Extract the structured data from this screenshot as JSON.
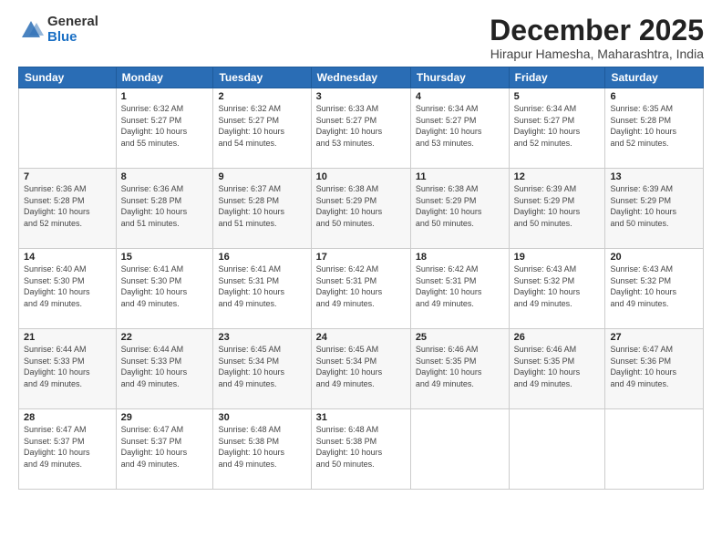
{
  "logo": {
    "general": "General",
    "blue": "Blue"
  },
  "title": "December 2025",
  "location": "Hirapur Hamesha, Maharashtra, India",
  "days_of_week": [
    "Sunday",
    "Monday",
    "Tuesday",
    "Wednesday",
    "Thursday",
    "Friday",
    "Saturday"
  ],
  "weeks": [
    [
      {
        "day": "",
        "info": ""
      },
      {
        "day": "1",
        "info": "Sunrise: 6:32 AM\nSunset: 5:27 PM\nDaylight: 10 hours\nand 55 minutes."
      },
      {
        "day": "2",
        "info": "Sunrise: 6:32 AM\nSunset: 5:27 PM\nDaylight: 10 hours\nand 54 minutes."
      },
      {
        "day": "3",
        "info": "Sunrise: 6:33 AM\nSunset: 5:27 PM\nDaylight: 10 hours\nand 53 minutes."
      },
      {
        "day": "4",
        "info": "Sunrise: 6:34 AM\nSunset: 5:27 PM\nDaylight: 10 hours\nand 53 minutes."
      },
      {
        "day": "5",
        "info": "Sunrise: 6:34 AM\nSunset: 5:27 PM\nDaylight: 10 hours\nand 52 minutes."
      },
      {
        "day": "6",
        "info": "Sunrise: 6:35 AM\nSunset: 5:28 PM\nDaylight: 10 hours\nand 52 minutes."
      }
    ],
    [
      {
        "day": "7",
        "info": "Sunrise: 6:36 AM\nSunset: 5:28 PM\nDaylight: 10 hours\nand 52 minutes."
      },
      {
        "day": "8",
        "info": "Sunrise: 6:36 AM\nSunset: 5:28 PM\nDaylight: 10 hours\nand 51 minutes."
      },
      {
        "day": "9",
        "info": "Sunrise: 6:37 AM\nSunset: 5:28 PM\nDaylight: 10 hours\nand 51 minutes."
      },
      {
        "day": "10",
        "info": "Sunrise: 6:38 AM\nSunset: 5:29 PM\nDaylight: 10 hours\nand 50 minutes."
      },
      {
        "day": "11",
        "info": "Sunrise: 6:38 AM\nSunset: 5:29 PM\nDaylight: 10 hours\nand 50 minutes."
      },
      {
        "day": "12",
        "info": "Sunrise: 6:39 AM\nSunset: 5:29 PM\nDaylight: 10 hours\nand 50 minutes."
      },
      {
        "day": "13",
        "info": "Sunrise: 6:39 AM\nSunset: 5:29 PM\nDaylight: 10 hours\nand 50 minutes."
      }
    ],
    [
      {
        "day": "14",
        "info": "Sunrise: 6:40 AM\nSunset: 5:30 PM\nDaylight: 10 hours\nand 49 minutes."
      },
      {
        "day": "15",
        "info": "Sunrise: 6:41 AM\nSunset: 5:30 PM\nDaylight: 10 hours\nand 49 minutes."
      },
      {
        "day": "16",
        "info": "Sunrise: 6:41 AM\nSunset: 5:31 PM\nDaylight: 10 hours\nand 49 minutes."
      },
      {
        "day": "17",
        "info": "Sunrise: 6:42 AM\nSunset: 5:31 PM\nDaylight: 10 hours\nand 49 minutes."
      },
      {
        "day": "18",
        "info": "Sunrise: 6:42 AM\nSunset: 5:31 PM\nDaylight: 10 hours\nand 49 minutes."
      },
      {
        "day": "19",
        "info": "Sunrise: 6:43 AM\nSunset: 5:32 PM\nDaylight: 10 hours\nand 49 minutes."
      },
      {
        "day": "20",
        "info": "Sunrise: 6:43 AM\nSunset: 5:32 PM\nDaylight: 10 hours\nand 49 minutes."
      }
    ],
    [
      {
        "day": "21",
        "info": "Sunrise: 6:44 AM\nSunset: 5:33 PM\nDaylight: 10 hours\nand 49 minutes."
      },
      {
        "day": "22",
        "info": "Sunrise: 6:44 AM\nSunset: 5:33 PM\nDaylight: 10 hours\nand 49 minutes."
      },
      {
        "day": "23",
        "info": "Sunrise: 6:45 AM\nSunset: 5:34 PM\nDaylight: 10 hours\nand 49 minutes."
      },
      {
        "day": "24",
        "info": "Sunrise: 6:45 AM\nSunset: 5:34 PM\nDaylight: 10 hours\nand 49 minutes."
      },
      {
        "day": "25",
        "info": "Sunrise: 6:46 AM\nSunset: 5:35 PM\nDaylight: 10 hours\nand 49 minutes."
      },
      {
        "day": "26",
        "info": "Sunrise: 6:46 AM\nSunset: 5:35 PM\nDaylight: 10 hours\nand 49 minutes."
      },
      {
        "day": "27",
        "info": "Sunrise: 6:47 AM\nSunset: 5:36 PM\nDaylight: 10 hours\nand 49 minutes."
      }
    ],
    [
      {
        "day": "28",
        "info": "Sunrise: 6:47 AM\nSunset: 5:37 PM\nDaylight: 10 hours\nand 49 minutes."
      },
      {
        "day": "29",
        "info": "Sunrise: 6:47 AM\nSunset: 5:37 PM\nDaylight: 10 hours\nand 49 minutes."
      },
      {
        "day": "30",
        "info": "Sunrise: 6:48 AM\nSunset: 5:38 PM\nDaylight: 10 hours\nand 49 minutes."
      },
      {
        "day": "31",
        "info": "Sunrise: 6:48 AM\nSunset: 5:38 PM\nDaylight: 10 hours\nand 50 minutes."
      },
      {
        "day": "",
        "info": ""
      },
      {
        "day": "",
        "info": ""
      },
      {
        "day": "",
        "info": ""
      }
    ]
  ]
}
